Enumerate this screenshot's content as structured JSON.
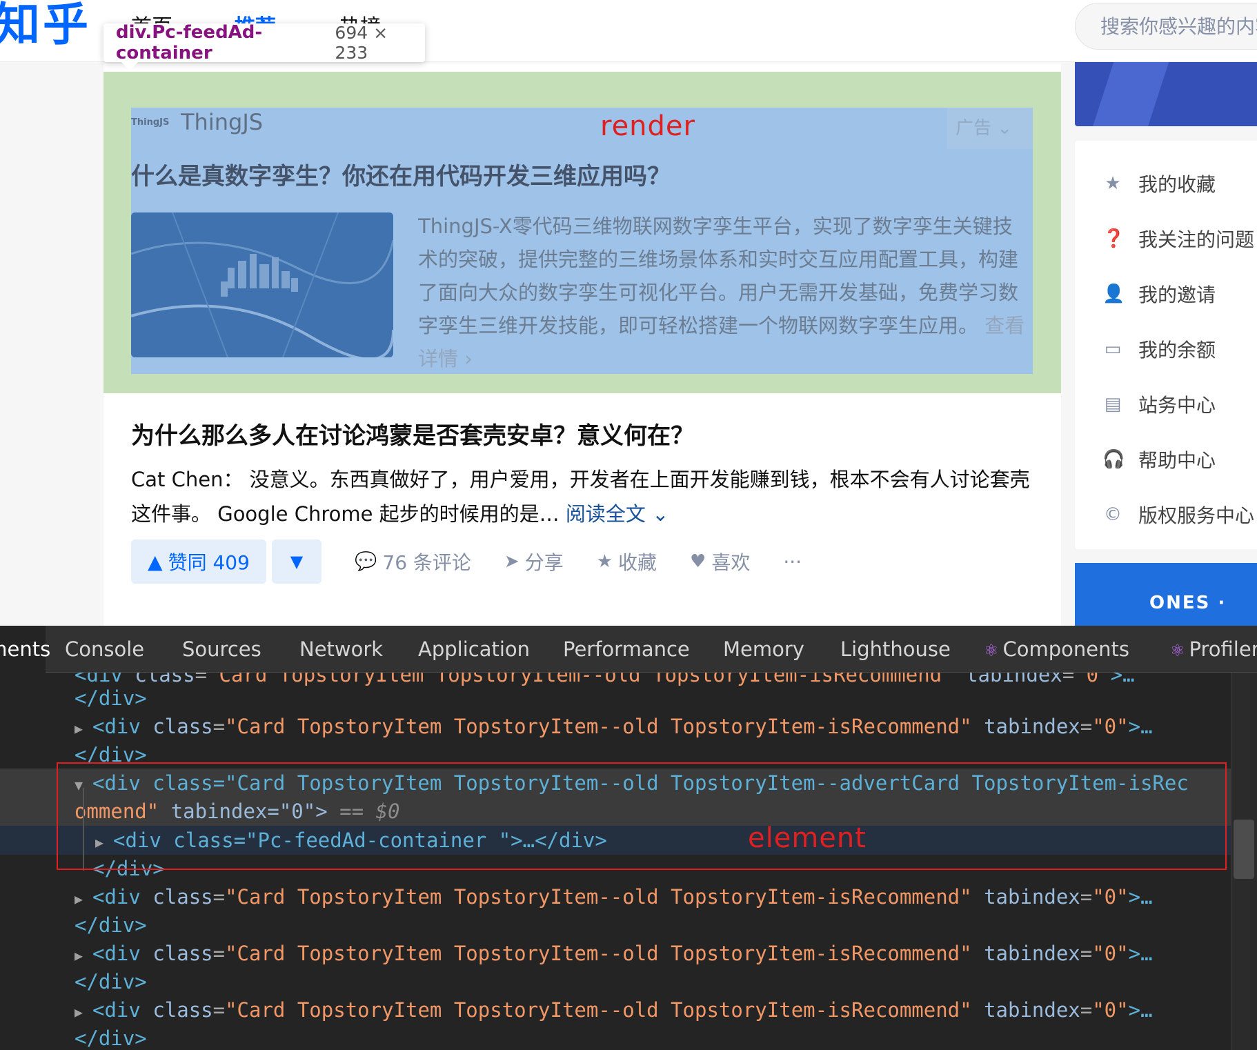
{
  "header": {
    "logo": "知乎",
    "tabs": [
      "首页",
      "推荐",
      "热榜"
    ],
    "search_placeholder": "搜索你感兴趣的内容"
  },
  "inspector_tooltip": {
    "selector": "div.Pc-feedAd-container",
    "size": "694 × 233"
  },
  "ad": {
    "logo_text": "ThingJS",
    "brand": "ThingJS",
    "tag": "广告",
    "title": "什么是真数字孪生？你还在用代码开发三维应用吗？",
    "description": "ThingJS-X零代码三维物联网数字孪生平台，实现了数字孪生关键技术的突破，提供完整的三维场景体系和实时交互应用配置工具，构建了面向大众的数字孪生可视化平台。用户无需开发基础，免费学习数字孪生三维开发技能，即可轻松搭建一个物联网数字孪生应用。",
    "more_link": "查看详情",
    "annotation": "render"
  },
  "question": {
    "title": "为什么那么多人在讨论鸿蒙是否套壳安卓？意义何在？",
    "excerpt": "Cat Chen： 没意义。东西真做好了，用户爱用，开发者在上面开发能赚到钱，根本不会有人讨论套壳这件事。 Google Chrome 起步的时候用的是…",
    "read_more": "阅读全文",
    "vote_up": "赞同 409",
    "comments": "76 条评论",
    "share": "分享",
    "favorite": "收藏",
    "like": "喜欢",
    "more": "···"
  },
  "sidebar": {
    "menu": [
      {
        "icon": "star-icon",
        "label": "我的收藏"
      },
      {
        "icon": "question-icon",
        "label": "我关注的问题"
      },
      {
        "icon": "add-user-icon",
        "label": "我的邀请"
      },
      {
        "icon": "wallet-icon",
        "label": "我的余额"
      },
      {
        "icon": "message-icon",
        "label": "站务中心"
      },
      {
        "icon": "headset-icon",
        "label": "帮助中心"
      },
      {
        "icon": "copyright-icon",
        "label": "版权服务中心"
      }
    ],
    "banner_text": "ONES ·"
  },
  "devtools": {
    "tabs": [
      "Elements",
      "Console",
      "Sources",
      "Network",
      "Application",
      "Performance",
      "Memory",
      "Lighthouse",
      "Components",
      "Profiler"
    ],
    "annotation": "element",
    "lines": [
      {
        "tag_open": "<div",
        "attr": "class",
        "value": "\"Card TopstoryItem TopstoryItem--old TopstoryItem-isRecommend\"",
        "attr2": "tabindex",
        "value2": "\"0\"",
        "close": ">…"
      },
      {
        "text": "</div>"
      },
      {
        "text": "</div>"
      },
      {
        "text": "</div>"
      },
      {
        "text": "</div>"
      }
    ],
    "selected_line_1": "<div class=\"Card TopstoryItem TopstoryItem--old TopstoryItem--advertCard TopstoryItem-isRec",
    "selected_line_2_value": "ommend\"",
    "selected_line_2_rest": "tabindex=\"0\">",
    "selected_marker": "== $0",
    "child_line": "<div class=\"Pc-feedAd-container \">…</div>"
  }
}
